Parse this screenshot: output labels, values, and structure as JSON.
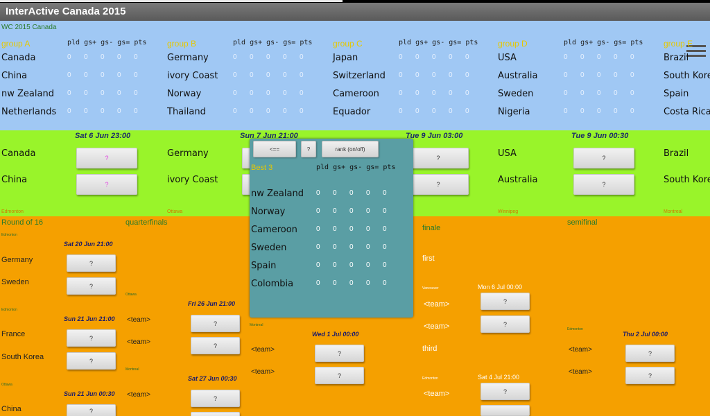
{
  "app": {
    "title": "InterActive Canada 2015"
  },
  "groups_section": {
    "label": "WC 2015 Canada",
    "col_headers": "pld gs+ gs- gs= pts",
    "groups": [
      {
        "title": "group A",
        "teams": [
          "Canada",
          "China",
          "nw Zealand",
          "Netherlands"
        ]
      },
      {
        "title": "group B",
        "teams": [
          "Germany",
          "ivory Coast",
          "Norway",
          "Thailand"
        ]
      },
      {
        "title": "group C",
        "teams": [
          "Japan",
          "Switzerland",
          "Cameroon",
          "Equador"
        ]
      },
      {
        "title": "group D",
        "teams": [
          "USA",
          "Australia",
          "Sweden",
          "Nigeria"
        ]
      },
      {
        "title": "group E",
        "teams": [
          "Brazil",
          "South Korea",
          "Spain",
          "Costa Rica"
        ]
      }
    ],
    "stat_value": "0"
  },
  "matches_section": {
    "dates": [
      "Sat 6 Jun 23:00",
      "Sun 7 Jun 21:00",
      "Tue 9 Jun 03:00",
      "Tue 9 Jun 00:30"
    ],
    "teams": {
      "a1": "Canada",
      "a2": "China",
      "b1": "Germany",
      "b2": "ivory Coast",
      "d1": "USA",
      "d2": "Australia",
      "e1": "Brazil",
      "e2": "South Korea"
    },
    "score_placeholder": "?",
    "venues": [
      "Edmonton",
      "Ottawa",
      "Winnipeg",
      "Montreal"
    ]
  },
  "overlay": {
    "back_label": "<==",
    "help_label": "?",
    "rank_label": "rank (on/off)",
    "title": "Best 3",
    "col_headers": "pld gs+ gs- gs= pts",
    "teams": [
      "nw Zealand",
      "Norway",
      "Cameroon",
      "Sweden",
      "Spain",
      "Colombia"
    ],
    "stat_value": "0"
  },
  "knockout": {
    "round16": "Round of 16",
    "quarterfinals": "quarterfinals",
    "finale": "finale",
    "semifinal": "semifinal",
    "first": "first",
    "third": "third",
    "team_placeholder": "<team>",
    "venues": {
      "edmonton": "Edmonton",
      "ottawa": "Ottawa",
      "montreal": "Montreal",
      "vancouver": "Vancouver"
    },
    "dates": {
      "r16_1": "Sat 20 Jun 21:00",
      "r16_2": "Sun 21 Jun 21:00",
      "r16_3": "Sun 21 Jun 00:30",
      "qf_1": "Fri 26 Jun 21:00",
      "qf_2": "Sat 27 Jun 00:30",
      "sf_1": "Wed 1 Jul 00:00",
      "sf_2": "Thu 2 Jul 00:00",
      "final": "Mon 6 Jul 00:00",
      "third": "Sat 4 Jul 21:00"
    },
    "r16_teams": [
      "Germany",
      "Sweden",
      "France",
      "South Korea",
      "China"
    ]
  }
}
